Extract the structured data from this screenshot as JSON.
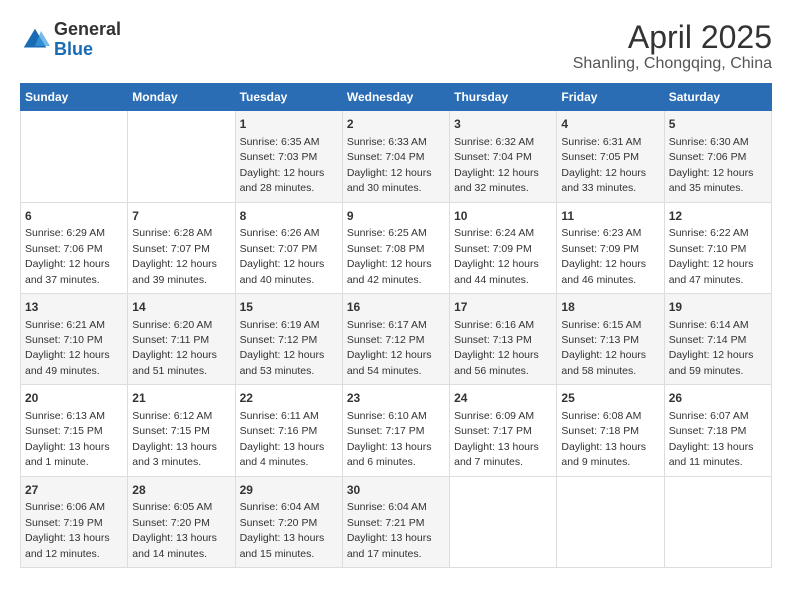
{
  "header": {
    "logo_general": "General",
    "logo_blue": "Blue",
    "month": "April 2025",
    "location": "Shanling, Chongqing, China"
  },
  "weekdays": [
    "Sunday",
    "Monday",
    "Tuesday",
    "Wednesday",
    "Thursday",
    "Friday",
    "Saturday"
  ],
  "weeks": [
    [
      {
        "day": "",
        "info": ""
      },
      {
        "day": "",
        "info": ""
      },
      {
        "day": "1",
        "info": "Sunrise: 6:35 AM\nSunset: 7:03 PM\nDaylight: 12 hours and 28 minutes."
      },
      {
        "day": "2",
        "info": "Sunrise: 6:33 AM\nSunset: 7:04 PM\nDaylight: 12 hours and 30 minutes."
      },
      {
        "day": "3",
        "info": "Sunrise: 6:32 AM\nSunset: 7:04 PM\nDaylight: 12 hours and 32 minutes."
      },
      {
        "day": "4",
        "info": "Sunrise: 6:31 AM\nSunset: 7:05 PM\nDaylight: 12 hours and 33 minutes."
      },
      {
        "day": "5",
        "info": "Sunrise: 6:30 AM\nSunset: 7:06 PM\nDaylight: 12 hours and 35 minutes."
      }
    ],
    [
      {
        "day": "6",
        "info": "Sunrise: 6:29 AM\nSunset: 7:06 PM\nDaylight: 12 hours and 37 minutes."
      },
      {
        "day": "7",
        "info": "Sunrise: 6:28 AM\nSunset: 7:07 PM\nDaylight: 12 hours and 39 minutes."
      },
      {
        "day": "8",
        "info": "Sunrise: 6:26 AM\nSunset: 7:07 PM\nDaylight: 12 hours and 40 minutes."
      },
      {
        "day": "9",
        "info": "Sunrise: 6:25 AM\nSunset: 7:08 PM\nDaylight: 12 hours and 42 minutes."
      },
      {
        "day": "10",
        "info": "Sunrise: 6:24 AM\nSunset: 7:09 PM\nDaylight: 12 hours and 44 minutes."
      },
      {
        "day": "11",
        "info": "Sunrise: 6:23 AM\nSunset: 7:09 PM\nDaylight: 12 hours and 46 minutes."
      },
      {
        "day": "12",
        "info": "Sunrise: 6:22 AM\nSunset: 7:10 PM\nDaylight: 12 hours and 47 minutes."
      }
    ],
    [
      {
        "day": "13",
        "info": "Sunrise: 6:21 AM\nSunset: 7:10 PM\nDaylight: 12 hours and 49 minutes."
      },
      {
        "day": "14",
        "info": "Sunrise: 6:20 AM\nSunset: 7:11 PM\nDaylight: 12 hours and 51 minutes."
      },
      {
        "day": "15",
        "info": "Sunrise: 6:19 AM\nSunset: 7:12 PM\nDaylight: 12 hours and 53 minutes."
      },
      {
        "day": "16",
        "info": "Sunrise: 6:17 AM\nSunset: 7:12 PM\nDaylight: 12 hours and 54 minutes."
      },
      {
        "day": "17",
        "info": "Sunrise: 6:16 AM\nSunset: 7:13 PM\nDaylight: 12 hours and 56 minutes."
      },
      {
        "day": "18",
        "info": "Sunrise: 6:15 AM\nSunset: 7:13 PM\nDaylight: 12 hours and 58 minutes."
      },
      {
        "day": "19",
        "info": "Sunrise: 6:14 AM\nSunset: 7:14 PM\nDaylight: 12 hours and 59 minutes."
      }
    ],
    [
      {
        "day": "20",
        "info": "Sunrise: 6:13 AM\nSunset: 7:15 PM\nDaylight: 13 hours and 1 minute."
      },
      {
        "day": "21",
        "info": "Sunrise: 6:12 AM\nSunset: 7:15 PM\nDaylight: 13 hours and 3 minutes."
      },
      {
        "day": "22",
        "info": "Sunrise: 6:11 AM\nSunset: 7:16 PM\nDaylight: 13 hours and 4 minutes."
      },
      {
        "day": "23",
        "info": "Sunrise: 6:10 AM\nSunset: 7:17 PM\nDaylight: 13 hours and 6 minutes."
      },
      {
        "day": "24",
        "info": "Sunrise: 6:09 AM\nSunset: 7:17 PM\nDaylight: 13 hours and 7 minutes."
      },
      {
        "day": "25",
        "info": "Sunrise: 6:08 AM\nSunset: 7:18 PM\nDaylight: 13 hours and 9 minutes."
      },
      {
        "day": "26",
        "info": "Sunrise: 6:07 AM\nSunset: 7:18 PM\nDaylight: 13 hours and 11 minutes."
      }
    ],
    [
      {
        "day": "27",
        "info": "Sunrise: 6:06 AM\nSunset: 7:19 PM\nDaylight: 13 hours and 12 minutes."
      },
      {
        "day": "28",
        "info": "Sunrise: 6:05 AM\nSunset: 7:20 PM\nDaylight: 13 hours and 14 minutes."
      },
      {
        "day": "29",
        "info": "Sunrise: 6:04 AM\nSunset: 7:20 PM\nDaylight: 13 hours and 15 minutes."
      },
      {
        "day": "30",
        "info": "Sunrise: 6:04 AM\nSunset: 7:21 PM\nDaylight: 13 hours and 17 minutes."
      },
      {
        "day": "",
        "info": ""
      },
      {
        "day": "",
        "info": ""
      },
      {
        "day": "",
        "info": ""
      }
    ]
  ]
}
